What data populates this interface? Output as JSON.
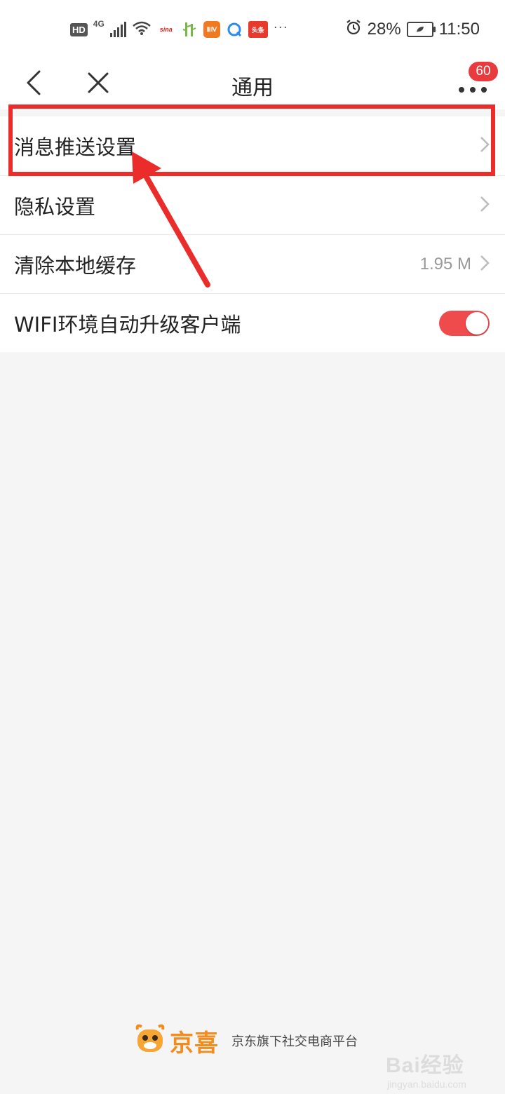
{
  "status_bar": {
    "hd_badge": "HD",
    "network_type": "4G",
    "app_icons": [
      {
        "icon": "sina-icon",
        "text": "sina",
        "color": "#e02020"
      },
      {
        "icon": "bamboo-app-icon",
        "text": "",
        "color": "#7ab648"
      },
      {
        "icon": "orange-app-icon",
        "text": "ⅢⅣ",
        "color": "#f07a22"
      },
      {
        "icon": "browser-app-icon",
        "text": "",
        "color": "#2b8cf0"
      },
      {
        "icon": "toutiao-icon",
        "text": "头条",
        "color": "#e8392d"
      }
    ],
    "more_indicator": "···",
    "battery_percent": "28%",
    "time": "11:50"
  },
  "nav": {
    "title": "通用",
    "notification_count": "60"
  },
  "settings": [
    {
      "label": "消息推送设置",
      "value": "",
      "control": "chevron"
    },
    {
      "label": "隐私设置",
      "value": "",
      "control": "chevron"
    },
    {
      "label": "清除本地缓存",
      "value": "1.95 M",
      "control": "chevron"
    },
    {
      "label": "WIFI环境自动升级客户端",
      "value": "",
      "control": "toggle",
      "toggle_on": true
    }
  ],
  "colors": {
    "accent": "#ef4a4c",
    "annotation": "#ea2c2a",
    "brand": "#f28c1c",
    "background": "#f5f5f5"
  },
  "footer": {
    "brand_name": "京喜",
    "slogan": "京东旗下社交电商平台"
  },
  "watermark": {
    "top": "Bai经验",
    "bottom": "jingyan.baidu.com"
  }
}
